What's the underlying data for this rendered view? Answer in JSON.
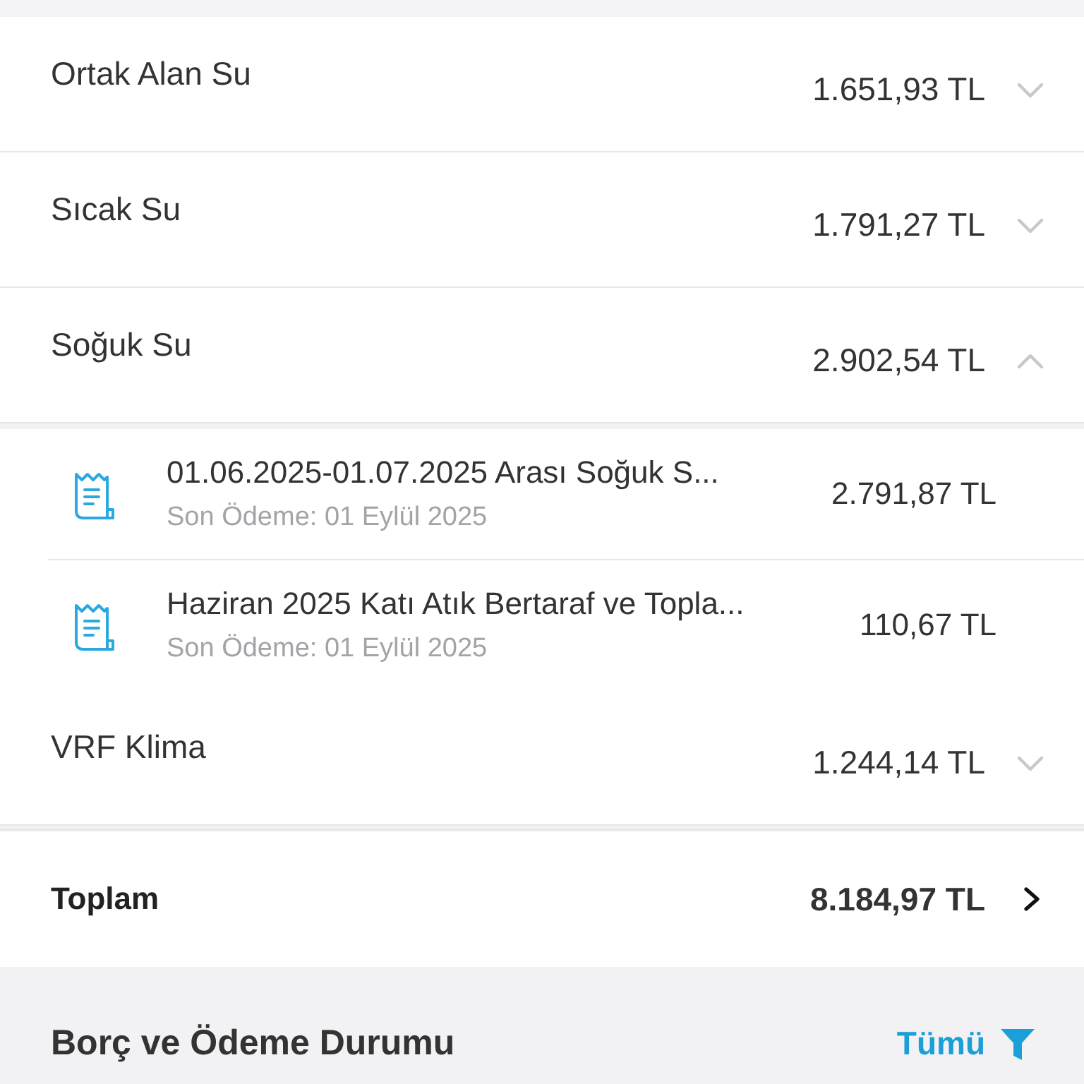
{
  "categories": [
    {
      "name": "Ortak Alan Su",
      "amount": "1.651,93 TL",
      "expanded": false
    },
    {
      "name": "Sıcak Su",
      "amount": "1.791,27 TL",
      "expanded": false
    },
    {
      "name": "Soğuk Su",
      "amount": "2.902,54 TL",
      "expanded": true,
      "items": [
        {
          "title": "01.06.2025-01.07.2025 Arası Soğuk S...",
          "due": "Son Ödeme: 01 Eylül 2025",
          "amount": "2.791,87 TL"
        },
        {
          "title": "Haziran 2025 Katı Atık Bertaraf ve Topla...",
          "due": "Son Ödeme: 01 Eylül 2025",
          "amount": "110,67 TL"
        }
      ]
    },
    {
      "name": "VRF Klima",
      "amount": "1.244,14 TL",
      "expanded": false
    }
  ],
  "total": {
    "label": "Toplam",
    "amount": "8.184,97 TL"
  },
  "section": {
    "title": "Borç ve Ödeme Durumu",
    "filter": "Tümü"
  }
}
